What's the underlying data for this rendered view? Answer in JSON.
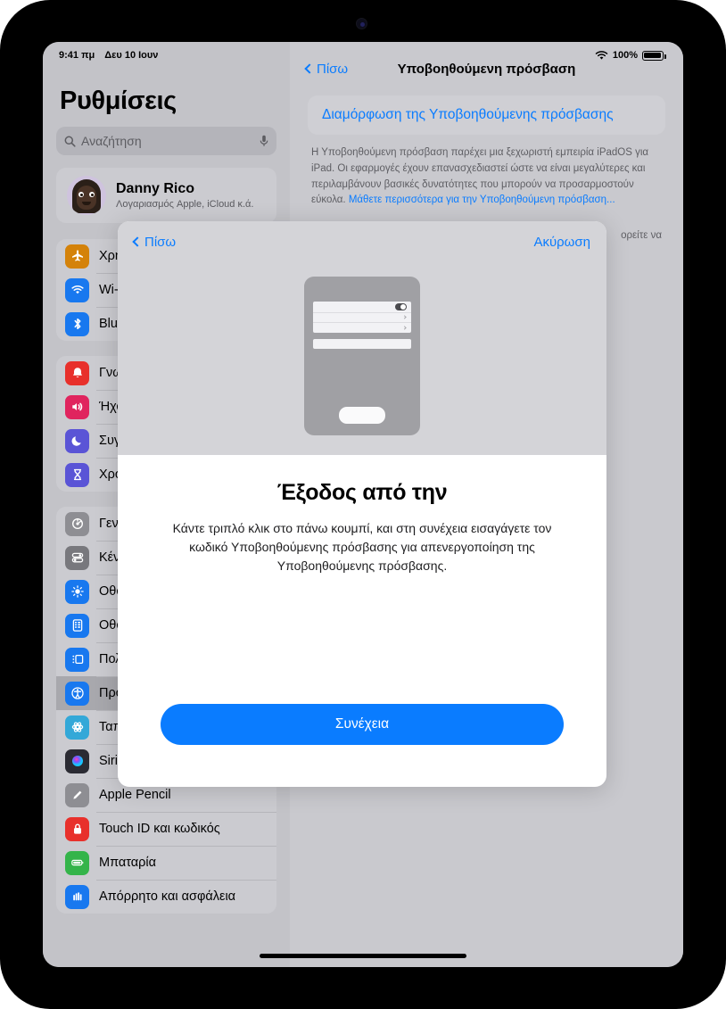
{
  "status_bar": {
    "time": "9:41 πμ",
    "date": "Δευ 10 Ιουν",
    "battery_percent": "100%",
    "wifi_icon": "wifi-icon",
    "battery_icon": "battery-icon"
  },
  "sidebar": {
    "title": "Ρυθμίσεις",
    "search": {
      "placeholder": "Αναζήτηση",
      "search_icon": "search-icon",
      "mic_icon": "microphone-icon"
    },
    "profile": {
      "name": "Danny Rico",
      "subtitle": "Λογαριασμός Apple, iCloud κ.ά."
    },
    "groups": [
      {
        "items": [
          {
            "label": "Χρήση σε πτήση",
            "icon": "airplane-icon",
            "color": "#d4820a"
          },
          {
            "label": "Wi-Fi",
            "icon": "wifi-icon",
            "color": "#1878ef"
          },
          {
            "label": "Bluetooth",
            "icon": "bluetooth-icon",
            "color": "#1878ef"
          }
        ]
      },
      {
        "items": [
          {
            "label": "Γνωστοποιήσεις",
            "icon": "bell-icon",
            "color": "#e8302b"
          },
          {
            "label": "Ήχοι",
            "icon": "speaker-icon",
            "color": "#e0245e"
          },
          {
            "label": "Συγκέντρωση",
            "icon": "moon-icon",
            "color": "#5a54d6"
          },
          {
            "label": "Χρόνος επί οθόνης",
            "icon": "hourglass-icon",
            "color": "#5a54d6"
          }
        ]
      },
      {
        "items": [
          {
            "label": "Γενικά",
            "icon": "gear-icon",
            "color": "#8e8e93"
          },
          {
            "label": "Κέντρο ελέγχου",
            "icon": "sliders-icon",
            "color": "#78787d"
          },
          {
            "label": "Οθόνη και φωτεινότητα",
            "icon": "brightness-icon",
            "color": "#1878ef"
          },
          {
            "label": "Οθόνη Home και Βιβλιοθήκη εφαρμογών",
            "icon": "home-screen-icon",
            "color": "#1878ef"
          },
          {
            "label": "Πολυδιεργασία και χειρονομίες",
            "icon": "multitasking-icon",
            "color": "#1878ef"
          },
          {
            "label": "Προσβασιμότητα",
            "icon": "accessibility-icon",
            "color": "#1878ef",
            "selected": true
          },
          {
            "label": "Ταπετσαρία",
            "icon": "wallpaper-icon",
            "color": "#33a8d8"
          },
          {
            "label": "Siri και Αναζήτηση",
            "icon": "siri-icon",
            "color": "#2b2b33"
          },
          {
            "label": "Apple Pencil",
            "icon": "pencil-icon",
            "color": "#8e8e93"
          },
          {
            "label": "Touch ID και κωδικός",
            "icon": "lock-icon",
            "color": "#e8302b"
          },
          {
            "label": "Μπαταρία",
            "icon": "battery-icon",
            "color": "#34b44a"
          },
          {
            "label": "Απόρρητο και ασφάλεια",
            "icon": "privacy-hand-icon",
            "color": "#1878ef"
          }
        ]
      }
    ]
  },
  "detail": {
    "back_label": "Πίσω",
    "title": "Υποβοηθούμενη πρόσβαση",
    "config_link": "Διαμόρφωση της Υποβοηθούμενης πρόσβασης",
    "description_part1": "Η Υποβοηθούμενη πρόσβαση παρέχει μια ξεχωριστή εμπειρία iPadOS για iPad. Οι εφαρμογές έχουν επανασχεδιαστεί ώστε να είναι μεγαλύτερες και περιλαμβάνουν βασικές δυνατότητες που μπορούν να προσαρμοστούν εύκολα. ",
    "description_link": "Μάθετε περισσότερα για την Υποβοηθούμενη πρόσβαση...",
    "tail_text": "ορείτε να"
  },
  "modal": {
    "back_label": "Πίσω",
    "cancel_label": "Ακύρωση",
    "illustration": "ipad-settings-illustration",
    "title": "Έξοδος από την",
    "body": "Κάντε τριπλό κλικ στο πάνω κουμπί, και στη συνέχεια εισαγάγετε τον κωδικό Υποβοηθούμενης πρόσβασης για απενεργοποίηση της Υποβοηθούμενης πρόσβασης.",
    "continue_label": "Συνέχεια"
  },
  "colors": {
    "accent": "#0a7cff",
    "screen_bg": "#c9c9ce",
    "modal_header_bg": "#d4d4d8"
  }
}
